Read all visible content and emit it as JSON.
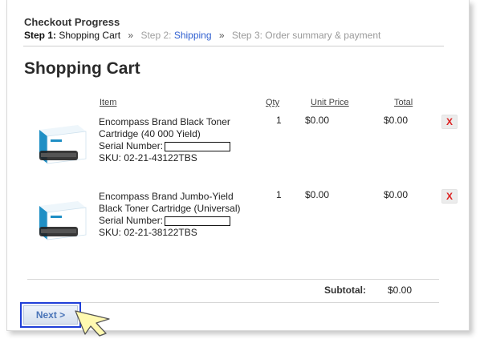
{
  "progress": {
    "title": "Checkout Progress",
    "step1_bold": "Step 1:",
    "step1_rest": " Shopping Cart",
    "sep": "»",
    "step2_label": "Step 2: ",
    "step2_link": "Shipping",
    "step3": "Step 3: Order summary & payment"
  },
  "cart": {
    "title": "Shopping Cart",
    "headers": {
      "item": "Item",
      "qty": "Qty",
      "unit_price": "Unit Price",
      "total": "Total"
    },
    "items": [
      {
        "line1": "Encompass Brand Black Toner",
        "line2": "Cartridge (40 000 Yield)",
        "serial_label": "Serial Number:",
        "sku": "SKU: 02-21-43122TBS",
        "qty": "1",
        "unit_price": "$0.00",
        "total": "$0.00",
        "remove": "X"
      },
      {
        "line1": "Encompass Brand Jumbo-Yield",
        "line2": "Black Toner Cartridge (Universal)",
        "serial_label": "Serial Number:",
        "sku": "SKU: 02-21-38122TBS",
        "qty": "1",
        "unit_price": "$0.00",
        "total": "$0.00",
        "remove": "X"
      }
    ],
    "subtotal_label": "Subtotal:",
    "subtotal_value": "$0.00"
  },
  "actions": {
    "next_label": "Next >"
  },
  "icons": {
    "cursor": "pointer-arrow-icon",
    "product": "toner-cartridge-box-icon",
    "remove": "remove-x-icon"
  },
  "colors": {
    "link": "#2f5fd0",
    "remove": "#dd2222",
    "highlight": "#1f3fd8",
    "next_text": "#4a74b8",
    "cursor_fill": "#fff9b0"
  }
}
